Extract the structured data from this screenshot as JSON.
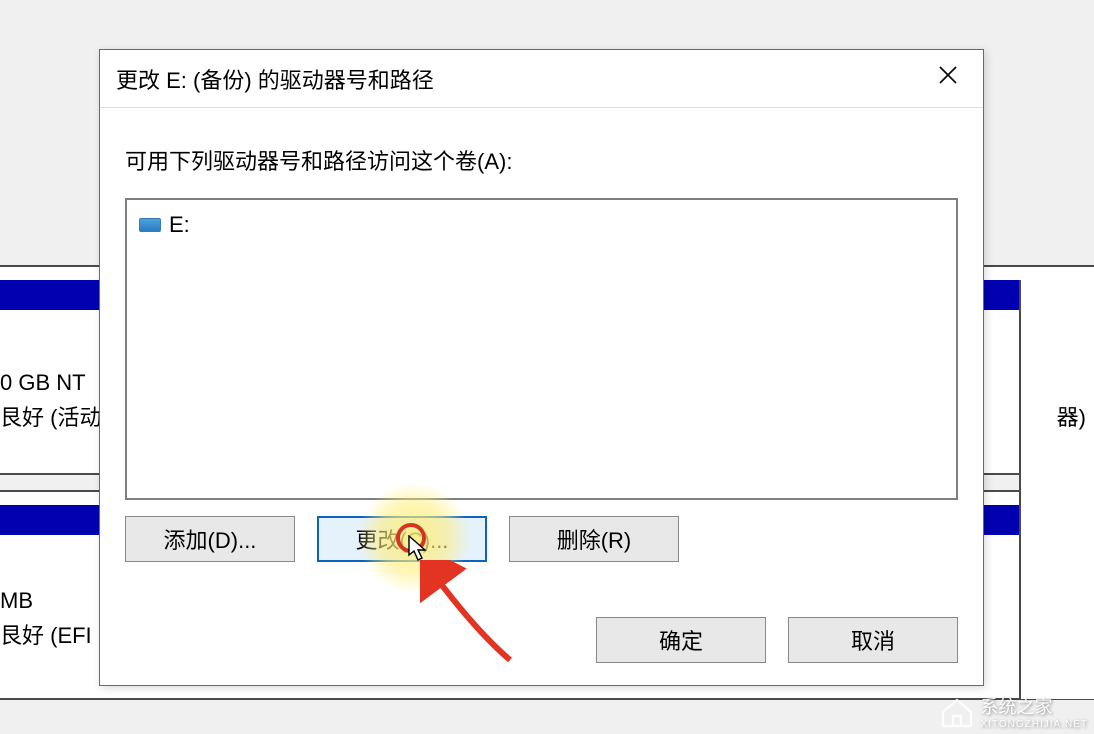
{
  "background": {
    "partition1_line1": "0 GB NT",
    "partition1_line2": "艮好 (活动",
    "partition2_line1": "MB",
    "partition2_line2": "艮好 (EFI 系",
    "right_fragment": "器)"
  },
  "dialog": {
    "title": "更改 E: (备份) 的驱动器号和路径",
    "instruction": "可用下列驱动器号和路径访问这个卷(A):",
    "list": {
      "items": [
        {
          "label": "E:"
        }
      ]
    },
    "buttons": {
      "add": "添加(D)...",
      "change": "更改(C)...",
      "remove": "删除(R)",
      "ok": "确定",
      "cancel": "取消"
    }
  },
  "watermark": {
    "text": "系统之家",
    "sub": "XITONGZHIJIA.NET"
  }
}
